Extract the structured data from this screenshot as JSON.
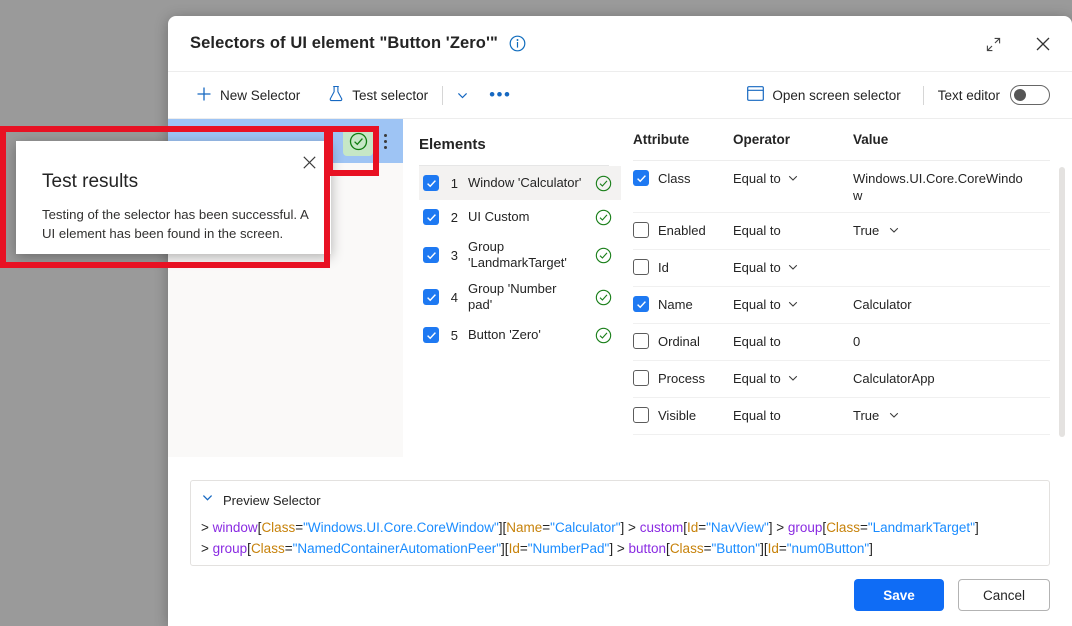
{
  "dialog": {
    "title": "Selectors of UI element \"Button 'Zero'\"",
    "info_icon": "info-icon",
    "expand_icon": "expand-diagonal-icon",
    "close_icon": "close-icon"
  },
  "toolbar": {
    "new_selector": "New Selector",
    "new_selector_icon": "plus-icon",
    "test_selector": "Test selector",
    "test_selector_icon": "flask-icon",
    "dropdown_icon": "chevron-down-icon",
    "overflow_icon": "ellipsis-icon",
    "open_screen_selector": "Open screen selector",
    "open_screen_selector_icon": "window-icon",
    "text_editor_label": "Text editor",
    "text_editor_state": "off"
  },
  "selector_list": {
    "badge_icon": "check-circle-green-icon",
    "kebab_icon": "more-vertical-icon",
    "selected_row_color": "#9ec4f4",
    "badge_color": "#c6e7c6"
  },
  "elements": {
    "title": "Elements",
    "items": [
      {
        "index": "1",
        "label": "Window 'Calculator'",
        "checked": true,
        "status": "success",
        "active": true
      },
      {
        "index": "2",
        "label": "UI Custom",
        "checked": true,
        "status": "success",
        "active": false
      },
      {
        "index": "3",
        "label": "Group 'LandmarkTarget'",
        "checked": true,
        "status": "success",
        "active": false
      },
      {
        "index": "4",
        "label": "Group 'Number pad'",
        "checked": true,
        "status": "success",
        "active": false
      },
      {
        "index": "5",
        "label": "Button 'Zero'",
        "checked": true,
        "status": "success",
        "active": false
      }
    ]
  },
  "attributes": {
    "headers": {
      "attribute": "Attribute",
      "operator": "Operator",
      "value": "Value"
    },
    "rows": [
      {
        "checked": true,
        "name": "Class",
        "operator": "Equal to",
        "op_chevron": true,
        "value": "Windows.UI.Core.CoreWindow",
        "val_chevron": false
      },
      {
        "checked": false,
        "name": "Enabled",
        "operator": "Equal to",
        "op_chevron": false,
        "value": "True",
        "val_chevron": true
      },
      {
        "checked": false,
        "name": "Id",
        "operator": "Equal to",
        "op_chevron": true,
        "value": "",
        "val_chevron": false
      },
      {
        "checked": true,
        "name": "Name",
        "operator": "Equal to",
        "op_chevron": true,
        "value": "Calculator",
        "val_chevron": false
      },
      {
        "checked": false,
        "name": "Ordinal",
        "operator": "Equal to",
        "op_chevron": false,
        "value": "0",
        "val_chevron": false
      },
      {
        "checked": false,
        "name": "Process",
        "operator": "Equal to",
        "op_chevron": true,
        "value": "CalculatorApp",
        "val_chevron": false
      },
      {
        "checked": false,
        "name": "Visible",
        "operator": "Equal to",
        "op_chevron": false,
        "value": "True",
        "val_chevron": true
      }
    ]
  },
  "preview": {
    "header": "Preview Selector",
    "chevron_icon": "chevron-down-icon",
    "lines": [
      [
        {
          "t": "gt",
          "x": "> "
        },
        {
          "t": "tag",
          "x": "window"
        },
        {
          "t": "brk",
          "x": "["
        },
        {
          "t": "attr",
          "x": "Class"
        },
        {
          "t": "brk",
          "x": "="
        },
        {
          "t": "val",
          "x": "\"Windows.UI.Core.CoreWindow\""
        },
        {
          "t": "brk",
          "x": "]["
        },
        {
          "t": "attr",
          "x": "Name"
        },
        {
          "t": "brk",
          "x": "="
        },
        {
          "t": "val",
          "x": "\"Calculator\""
        },
        {
          "t": "brk",
          "x": "] "
        },
        {
          "t": "gt",
          "x": "> "
        },
        {
          "t": "tag",
          "x": "custom"
        },
        {
          "t": "brk",
          "x": "["
        },
        {
          "t": "attr",
          "x": "Id"
        },
        {
          "t": "brk",
          "x": "="
        },
        {
          "t": "val",
          "x": "\"NavView\""
        },
        {
          "t": "brk",
          "x": "] "
        },
        {
          "t": "gt",
          "x": "> "
        },
        {
          "t": "tag",
          "x": "group"
        },
        {
          "t": "brk",
          "x": "["
        },
        {
          "t": "attr",
          "x": "Class"
        },
        {
          "t": "brk",
          "x": "="
        },
        {
          "t": "val",
          "x": "\"LandmarkTarget\""
        },
        {
          "t": "brk",
          "x": "]"
        }
      ],
      [
        {
          "t": "gt",
          "x": "> "
        },
        {
          "t": "tag",
          "x": "group"
        },
        {
          "t": "brk",
          "x": "["
        },
        {
          "t": "attr",
          "x": "Class"
        },
        {
          "t": "brk",
          "x": "="
        },
        {
          "t": "val",
          "x": "\"NamedContainerAutomationPeer\""
        },
        {
          "t": "brk",
          "x": "]["
        },
        {
          "t": "attr",
          "x": "Id"
        },
        {
          "t": "brk",
          "x": "="
        },
        {
          "t": "val",
          "x": "\"NumberPad\""
        },
        {
          "t": "brk",
          "x": "] "
        },
        {
          "t": "gt",
          "x": "> "
        },
        {
          "t": "tag",
          "x": "button"
        },
        {
          "t": "brk",
          "x": "["
        },
        {
          "t": "attr",
          "x": "Class"
        },
        {
          "t": "brk",
          "x": "="
        },
        {
          "t": "val",
          "x": "\"Button\""
        },
        {
          "t": "brk",
          "x": "]["
        },
        {
          "t": "attr",
          "x": "Id"
        },
        {
          "t": "brk",
          "x": "="
        },
        {
          "t": "val",
          "x": "\"num0Button\""
        },
        {
          "t": "brk",
          "x": "]"
        }
      ]
    ]
  },
  "footer": {
    "save": "Save",
    "cancel": "Cancel",
    "save_color": "#0f6cf5"
  },
  "test_results": {
    "title": "Test results",
    "body": "Testing of the selector has been successful. A UI element has been found in the screen.",
    "close_icon": "close-icon"
  },
  "annotations": {
    "highlight_color": "#e81123"
  }
}
